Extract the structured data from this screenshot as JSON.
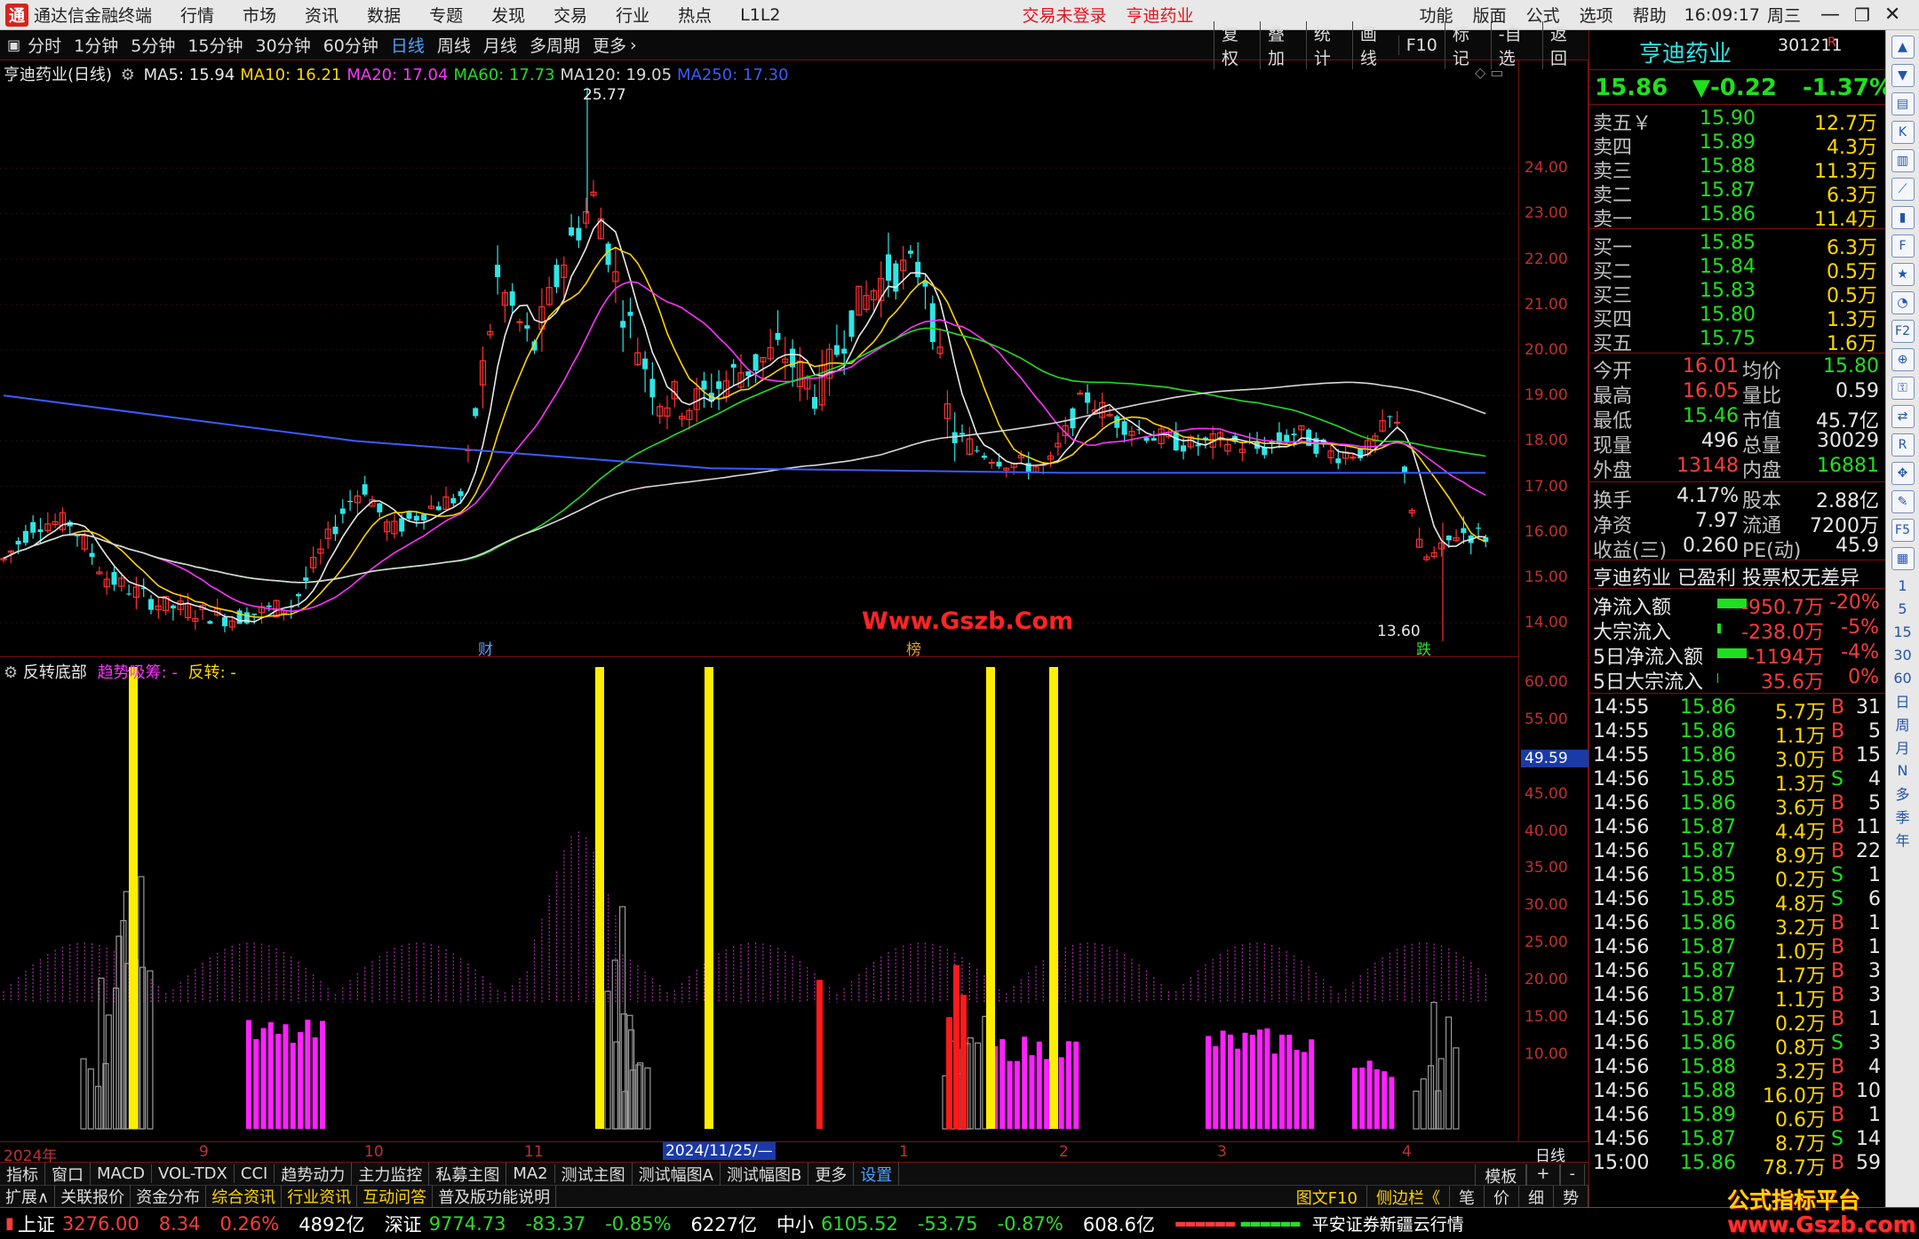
{
  "window": {
    "app_title": "通达信金融终端",
    "menu": [
      "行情",
      "市场",
      "资讯",
      "数据",
      "专题",
      "发现",
      "交易",
      "行业",
      "热点",
      "L1L2"
    ],
    "trade_status": "交易未登录",
    "stock_name_tab": "亨迪药业",
    "right_menu": [
      "功能",
      "版面",
      "公式",
      "选项",
      "帮助"
    ],
    "clock": "16:09:17",
    "weekday": "周三"
  },
  "periods": {
    "items": [
      "分时",
      "1分钟",
      "5分钟",
      "15分钟",
      "30分钟",
      "60分钟",
      "日线",
      "周线",
      "月线",
      "多周期",
      "更多"
    ],
    "active": "日线",
    "right_tools": [
      "复权",
      "叠加",
      "统计",
      "画线",
      "F10",
      "标记",
      "-自选",
      "返回"
    ]
  },
  "main_chart": {
    "title": "亨迪药业(日线)",
    "ma_legend": [
      {
        "label": "MA5: 15.94",
        "color": "#e8e8e8"
      },
      {
        "label": "MA10: 16.21",
        "color": "#ffd400"
      },
      {
        "label": "MA20: 17.04",
        "color": "#ff33ff"
      },
      {
        "label": "MA60: 17.73",
        "color": "#22dd22"
      },
      {
        "label": "MA120: 19.05",
        "color": "#d8d8d8"
      },
      {
        "label": "MA250: 17.30",
        "color": "#3a5cff"
      }
    ],
    "price_ticks": [
      "24.00",
      "23.00",
      "22.00",
      "21.00",
      "20.00",
      "19.00",
      "18.00",
      "17.00",
      "16.00",
      "15.00",
      "14.00"
    ],
    "high_marker": "25.77",
    "low_marker": "13.60",
    "event_markers": [
      "财",
      "榜",
      "跌"
    ],
    "watermark": "Www.Gszb.Com"
  },
  "sub_chart": {
    "title": "反转底部",
    "legend": [
      {
        "label": "趋势吸筹: -",
        "color": "#ff33ff"
      },
      {
        "label": "反转: -",
        "color": "#ffd700"
      }
    ],
    "axis_ticks": [
      "60.00",
      "55.00",
      "50.00",
      "45.00",
      "40.00",
      "35.00",
      "30.00",
      "25.00",
      "20.00",
      "15.00",
      "10.00"
    ],
    "current_value": "49.59"
  },
  "chart_data": {
    "type": "bar",
    "panels": [
      {
        "name": "price",
        "description": "daily candlesticks with MA5/10/20/60/120/250",
        "ylim": [
          13.5,
          25.8
        ],
        "high": 25.77,
        "low": 13.6
      },
      {
        "name": "反转底部",
        "ylim": [
          0,
          62
        ],
        "series": [
          {
            "name": "反转",
            "color": "#ffd700",
            "values_at": [
              150,
              675,
              798,
              1115,
              1186
            ],
            "values": [
              62,
              62,
              62,
              62,
              62
            ]
          },
          {
            "name": "趋势吸筹",
            "color": "#ff33ff"
          }
        ]
      }
    ]
  },
  "date_axis": {
    "labels": [
      "2024年",
      "9",
      "10",
      "11",
      "2024/11/25/—",
      "1",
      "2",
      "3",
      "4"
    ],
    "period_label": "日线"
  },
  "tabs_row1": [
    "指标",
    "窗口",
    "MACD",
    "VOL-TDX",
    "CCI",
    "趋势动力",
    "主力监控",
    "私募主图",
    "MA2",
    "测试主图",
    "测试幅图A",
    "测试幅图B",
    "更多",
    "设置"
  ],
  "tabs_row1_right": [
    "模板",
    "+",
    "-"
  ],
  "tabs_row2": [
    "扩展∧",
    "关联报价",
    "资金分布",
    "综合资讯",
    "行业资讯",
    "互动问答",
    "普及版功能说明"
  ],
  "tabs_row2_right": [
    "图文F10",
    "侧边栏《",
    "笔",
    "价",
    "细",
    "势"
  ],
  "quote": {
    "name": "亨迪药业",
    "code": "301211",
    "flag": "R",
    "price": "15.86",
    "change": "▼-0.22",
    "pct": "-1.37%",
    "asks": [
      {
        "label": "卖五￥",
        "price": "15.90",
        "vol": "12.7万"
      },
      {
        "label": "卖四",
        "price": "15.89",
        "vol": "4.3万"
      },
      {
        "label": "卖三",
        "price": "15.88",
        "vol": "11.3万"
      },
      {
        "label": "卖二",
        "price": "15.87",
        "vol": "6.3万"
      },
      {
        "label": "卖一",
        "price": "15.86",
        "vol": "11.4万"
      }
    ],
    "bids": [
      {
        "label": "买一",
        "price": "15.85",
        "vol": "6.3万"
      },
      {
        "label": "买二",
        "price": "15.84",
        "vol": "0.5万"
      },
      {
        "label": "买三",
        "price": "15.83",
        "vol": "0.5万"
      },
      {
        "label": "买四",
        "price": "15.80",
        "vol": "1.3万"
      },
      {
        "label": "买五",
        "price": "15.75",
        "vol": "1.6万"
      }
    ],
    "stats": [
      {
        "l1": "今开",
        "v1": "16.01",
        "c1": "red",
        "l2": "均价",
        "v2": "15.80",
        "c2": "grn"
      },
      {
        "l1": "最高",
        "v1": "16.05",
        "c1": "red",
        "l2": "量比",
        "v2": "0.59",
        "c2": "wht"
      },
      {
        "l1": "最低",
        "v1": "15.46",
        "c1": "grn",
        "l2": "市值",
        "v2": "45.7亿",
        "c2": "wht"
      },
      {
        "l1": "现量",
        "v1": "496",
        "c1": "wht",
        "l2": "总量",
        "v2": "30029",
        "c2": "wht"
      },
      {
        "l1": "外盘",
        "v1": "13148",
        "c1": "red",
        "l2": "内盘",
        "v2": "16881",
        "c2": "grn"
      }
    ],
    "stats2": [
      {
        "l1": "换手",
        "v1": "4.17%",
        "l2": "股本",
        "v2": "2.88亿"
      },
      {
        "l1": "净资",
        "v1": "7.97",
        "l2": "流通",
        "v2": "7200万"
      },
      {
        "l1": "收益(三)",
        "v1": "0.260",
        "l2": "PE(动)",
        "v2": "45.9"
      }
    ],
    "profile": "亨迪药业 已盈利 投票权无差异",
    "flows": [
      {
        "label": "净流入额",
        "val": "-950.7万",
        "pct": "-20%",
        "bar": 0.55,
        "vc": "red",
        "pc": "red"
      },
      {
        "label": "大宗流入",
        "val": "-238.0万",
        "pct": "-5%",
        "bar": 0.06,
        "vc": "red",
        "pc": "red"
      },
      {
        "label": "5日净流入额",
        "val": "-1194万",
        "pct": "-4%",
        "bar": 0.55,
        "vc": "red",
        "pc": "red"
      },
      {
        "label": "5日大宗流入",
        "val": "35.6万",
        "pct": "0%",
        "bar": 0.02,
        "vc": "red",
        "pc": "red"
      }
    ],
    "ticks": [
      {
        "t": "14:55",
        "p": "15.86",
        "v": "5.7万",
        "d": "B",
        "n": "31"
      },
      {
        "t": "14:55",
        "p": "15.86",
        "v": "1.1万",
        "d": "B",
        "n": "5"
      },
      {
        "t": "14:55",
        "p": "15.86",
        "v": "3.0万",
        "d": "B",
        "n": "15"
      },
      {
        "t": "14:56",
        "p": "15.85",
        "v": "1.3万",
        "d": "S",
        "n": "4"
      },
      {
        "t": "14:56",
        "p": "15.86",
        "v": "3.6万",
        "d": "B",
        "n": "5"
      },
      {
        "t": "14:56",
        "p": "15.87",
        "v": "4.4万",
        "d": "B",
        "n": "11"
      },
      {
        "t": "14:56",
        "p": "15.87",
        "v": "8.9万",
        "d": "B",
        "n": "22"
      },
      {
        "t": "14:56",
        "p": "15.85",
        "v": "0.2万",
        "d": "S",
        "n": "1"
      },
      {
        "t": "14:56",
        "p": "15.85",
        "v": "4.8万",
        "d": "S",
        "n": "6"
      },
      {
        "t": "14:56",
        "p": "15.86",
        "v": "3.2万",
        "d": "B",
        "n": "1"
      },
      {
        "t": "14:56",
        "p": "15.87",
        "v": "1.0万",
        "d": "B",
        "n": "1"
      },
      {
        "t": "14:56",
        "p": "15.87",
        "v": "1.7万",
        "d": "B",
        "n": "3"
      },
      {
        "t": "14:56",
        "p": "15.87",
        "v": "1.1万",
        "d": "B",
        "n": "3"
      },
      {
        "t": "14:56",
        "p": "15.87",
        "v": "0.2万",
        "d": "B",
        "n": "1"
      },
      {
        "t": "14:56",
        "p": "15.86",
        "v": "0.8万",
        "d": "S",
        "n": "3"
      },
      {
        "t": "14:56",
        "p": "15.88",
        "v": "3.2万",
        "d": "B",
        "n": "4"
      },
      {
        "t": "14:56",
        "p": "15.88",
        "v": "16.0万",
        "d": "B",
        "n": "10"
      },
      {
        "t": "14:56",
        "p": "15.89",
        "v": "0.6万",
        "d": "B",
        "n": "1"
      },
      {
        "t": "14:56",
        "p": "15.87",
        "v": "8.7万",
        "d": "S",
        "n": "14"
      },
      {
        "t": "15:00",
        "p": "15.86",
        "v": "78.7万",
        "d": "B",
        "n": "59"
      }
    ]
  },
  "status": {
    "sh_label": "上证",
    "sh_val": "3276.00",
    "sh_chg": "8.34",
    "sh_pct": "0.26%",
    "sh_amt": "4892亿",
    "sz_label": "深证",
    "sz_val": "9774.73",
    "sz_chg": "-83.37",
    "sz_pct": "-0.85%",
    "sz_amt": "6227亿",
    "zx_label": "中小",
    "zx_val": "6105.52",
    "zx_chg": "-53.75",
    "zx_pct": "-0.87%",
    "zx_amt": "608.6亿",
    "broker": "平安证券新疆云行情"
  },
  "side_icons": [
    "up-arrow",
    "down-arrow",
    "chart",
    "K",
    "bars",
    "line",
    "bar",
    "F10",
    "star",
    "pie",
    "F2",
    "zoom",
    "lock",
    "swap",
    "RSI",
    "move",
    "pen",
    "F5",
    "grid",
    "1",
    "5",
    "15",
    "30",
    "60",
    "日",
    "周",
    "月",
    "N",
    "多",
    "季",
    "年"
  ],
  "brand_watermark": "公式指标平台\nwww.Gszb.com"
}
